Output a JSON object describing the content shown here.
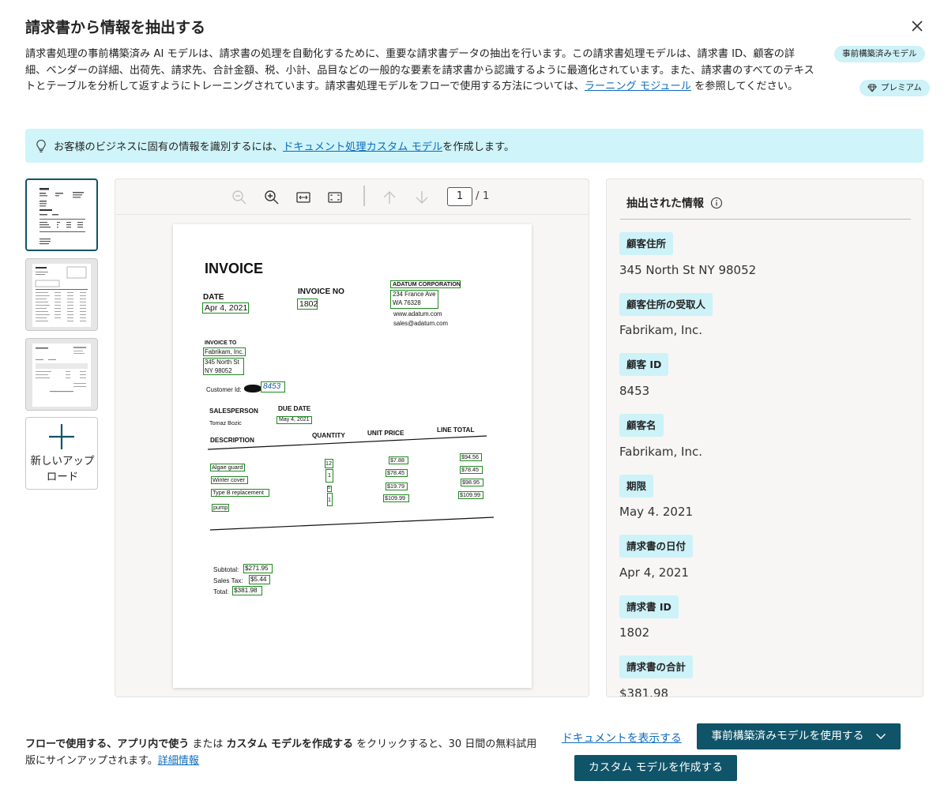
{
  "dialog": {
    "title": "請求書から情報を抽出する",
    "description_pre": "請求書処理の事前構築済み AI モデルは、請求書の処理を自動化するために、重要な請求書データの抽出を行います。この請求書処理モデルは、請求書 ID、顧客の詳細、ベンダーの詳細、出荷先、請求先、合計金額、税、小計、品目などの一般的な要素を請求書から認識するように最適化されています。また、請求書のすべてのテキストとテーブルを分析して返すようにトレーニングされています。請求書処理モデルをフローで使用する方法については、",
    "description_link": "ラーニング モジュール",
    "description_post": " を参照してください。",
    "badge_prebuilt": "事前構築済みモデル",
    "badge_premium": "プレミアム"
  },
  "banner": {
    "text_pre": "お客様のビジネスに固有の情報を識別するには、",
    "link": "ドキュメント処理カスタム モデル",
    "text_post": " を作成します。"
  },
  "sidebar": {
    "upload_label": "新しいアップロード"
  },
  "viewer": {
    "page_current": "1",
    "page_total": "/ 1",
    "invoice": {
      "title": "INVOICE",
      "date_label": "DATE",
      "date_value": "Apr 4, 2021",
      "invoice_no_label": "INVOICE NO",
      "invoice_no_value": "1802",
      "vendor_name": "ADATUM CORPORATION",
      "vendor_street": "234 France Ave",
      "vendor_city": "WA 76328",
      "vendor_web": "www.adatum.com",
      "vendor_email": "sales@adatum.com",
      "invoice_to_label": "INVOICE TO",
      "customer_name": "Fabrikam, Inc.",
      "customer_street": "345 North St",
      "customer_city": "NY 98052",
      "customer_id_label": "Customer Id:",
      "customer_id_value": "8453",
      "salesperson_label": "SALESPERSON",
      "salesperson_value": "Tomaz Bozic",
      "due_date_label": "DUE DATE",
      "due_date_value": "May 4, 2021",
      "col_description": "DESCRIPTION",
      "col_quantity": "QUANTITY",
      "col_unit_price": "UNIT PRICE",
      "col_line_total": "LINE TOTAL",
      "items": [
        {
          "desc": "Algae guard",
          "qty": "12",
          "price": "$7.88",
          "total": "$94.56"
        },
        {
          "desc": "Winter cover",
          "qty": "1",
          "price": "$78.45",
          "total": "$78.45"
        },
        {
          "desc": "Type B replacement",
          "qty": "5",
          "price": "$19.79",
          "total": "$98.95"
        },
        {
          "desc": "pump",
          "qty": "1",
          "price": "$109.99",
          "total": "$109.99"
        }
      ],
      "subtotal_label": "Subtotal:",
      "subtotal_value": "$271.95",
      "tax_label": "Sales Tax:",
      "tax_value": "$5.44",
      "total_label": "Total:",
      "total_value": "$381.98"
    }
  },
  "extracted": {
    "title": "抽出された情報",
    "fields": [
      {
        "label": "顧客住所",
        "value": "345 North St NY 98052"
      },
      {
        "label": "顧客住所の受取人",
        "value": "Fabrikam, Inc."
      },
      {
        "label": "顧客 ID",
        "value": "8453"
      },
      {
        "label": "顧客名",
        "value": "Fabrikam, Inc."
      },
      {
        "label": "期限",
        "value": "May 4. 2021"
      },
      {
        "label": "請求書の日付",
        "value": "Apr 4, 2021"
      },
      {
        "label": "請求書 ID",
        "value": "1802"
      },
      {
        "label": "請求書の合計",
        "value": "$381.98"
      }
    ]
  },
  "footer": {
    "part1": "フローで使用する、アプリ内で使う",
    "part2": " または ",
    "part3": "カスタム モデルを作成する",
    "part4": " をクリックすると、30 日間の無料試用版にサインアップされます。",
    "link": "詳細情報",
    "show_document": "ドキュメントを表示する",
    "use_prebuilt": "事前構築済みモデルを使用する",
    "create_custom": "カスタム モデルを作成する"
  },
  "colors": {
    "accent": "#0f5468",
    "badge_bg": "#cdf2f8",
    "banner_bg": "#cff4f9",
    "link": "#0f6cbd",
    "box_green": "#1e8a1e"
  }
}
